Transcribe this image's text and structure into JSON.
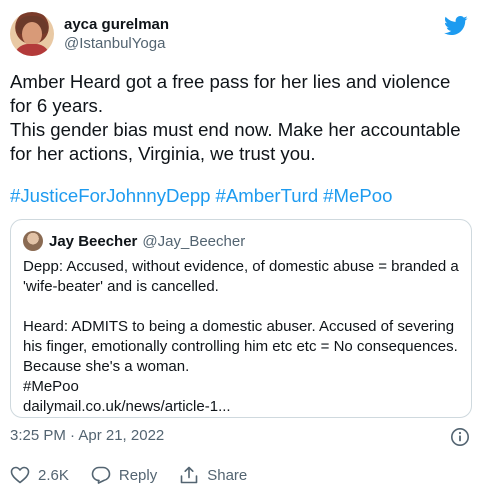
{
  "author": {
    "display_name": "ayca gurelman",
    "handle": "@IstanbulYoga"
  },
  "tweet": {
    "text": "Amber Heard got a free pass for her lies and violence for 6 years.\nThis gender bias must end now. Make her accountable for her actions, Virginia, we trust you.",
    "hashtags": [
      "#JusticeForJohnnyDepp",
      "#AmberTurd",
      "#MePoo"
    ]
  },
  "quoted": {
    "display_name": "Jay Beecher",
    "handle": "@Jay_Beecher",
    "paragraph1": "Depp: Accused, without evidence, of domestic abuse = branded a 'wife-beater' and is cancelled.",
    "paragraph2": "Heard: ADMITS to being a domestic abuser. Accused of severing his finger, emotionally controlling him etc etc = No consequences. Because she's a woman.",
    "hashtag": "#MePoo",
    "link": "dailymail.co.uk/news/article-1..."
  },
  "meta": {
    "timestamp": "3:25 PM · Apr 21, 2022"
  },
  "actions": {
    "likes": "2.6K",
    "reply_label": "Reply",
    "share_label": "Share"
  },
  "colors": {
    "accent": "#1d9bf0",
    "text": "#0f1419",
    "secondary": "#536471",
    "border": "#cfd9de"
  },
  "icons": [
    "twitter-bird-icon",
    "info-icon",
    "heart-icon",
    "reply-icon",
    "share-icon"
  ]
}
